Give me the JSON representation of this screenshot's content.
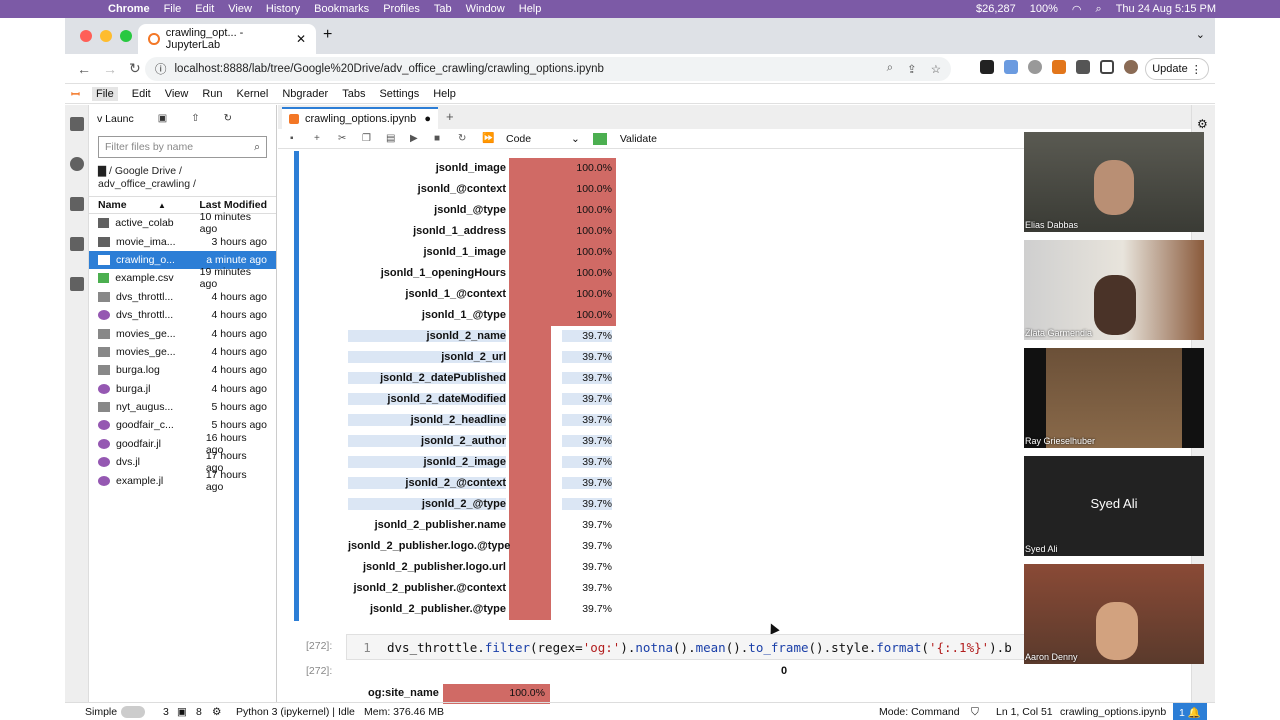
{
  "mac_menubar": {
    "app": "Chrome",
    "items": [
      "File",
      "Edit",
      "View",
      "History",
      "Bookmarks",
      "Profiles",
      "Tab",
      "Window",
      "Help"
    ],
    "right": [
      "$26,287",
      "100%",
      "Thu 24 Aug  5:15 PM"
    ]
  },
  "browser_tab": {
    "title": "crawling_opt... - JupyterLab"
  },
  "address": {
    "url": "localhost:8888/lab/tree/Google%20Drive/adv_office_crawling/crawling_options.ipynb"
  },
  "update_label": "Update",
  "jupyter_menu": [
    "File",
    "Edit",
    "View",
    "Run",
    "Kernel",
    "Nbgrader",
    "Tabs",
    "Settings",
    "Help"
  ],
  "file_browser": {
    "launcher_label": "v Launc",
    "filter_placeholder": "Filter files by name",
    "breadcrumb": "/ Google Drive / adv_office_crawling /",
    "col_name": "Name",
    "col_modified": "Last Modified",
    "files": [
      {
        "name": "active_colab",
        "modified": "10 minutes ago",
        "type": "folder"
      },
      {
        "name": "movie_ima...",
        "modified": "3 hours ago",
        "type": "folder"
      },
      {
        "name": "crawling_o...",
        "modified": "a minute ago",
        "type": "notebook",
        "selected": true
      },
      {
        "name": "example.csv",
        "modified": "19 minutes ago",
        "type": "csv"
      },
      {
        "name": "dvs_throttl...",
        "modified": "4 hours ago",
        "type": "file"
      },
      {
        "name": "dvs_throttl...",
        "modified": "4 hours ago",
        "type": "julia"
      },
      {
        "name": "movies_ge...",
        "modified": "4 hours ago",
        "type": "file"
      },
      {
        "name": "movies_ge...",
        "modified": "4 hours ago",
        "type": "file"
      },
      {
        "name": "burga.log",
        "modified": "4 hours ago",
        "type": "file"
      },
      {
        "name": "burga.jl",
        "modified": "4 hours ago",
        "type": "julia"
      },
      {
        "name": "nyt_augus...",
        "modified": "5 hours ago",
        "type": "file"
      },
      {
        "name": "goodfair_c...",
        "modified": "5 hours ago",
        "type": "julia"
      },
      {
        "name": "goodfair.jl",
        "modified": "16 hours ago",
        "type": "julia"
      },
      {
        "name": "dvs.jl",
        "modified": "17 hours ago",
        "type": "julia"
      },
      {
        "name": "example.jl",
        "modified": "17 hours ago",
        "type": "julia"
      }
    ]
  },
  "notebook": {
    "tab_title": "crawling_options.ipynb",
    "cell_type": "Code",
    "validate_label": "Validate",
    "rows": [
      {
        "label": "jsonld_image",
        "pct": "100.0%",
        "fraction": 1.0
      },
      {
        "label": "jsonld_@context",
        "pct": "100.0%",
        "fraction": 1.0
      },
      {
        "label": "jsonld_@type",
        "pct": "100.0%",
        "fraction": 1.0
      },
      {
        "label": "jsonld_1_address",
        "pct": "100.0%",
        "fraction": 1.0
      },
      {
        "label": "jsonld_1_image",
        "pct": "100.0%",
        "fraction": 1.0
      },
      {
        "label": "jsonld_1_openingHours",
        "pct": "100.0%",
        "fraction": 1.0
      },
      {
        "label": "jsonld_1_@context",
        "pct": "100.0%",
        "fraction": 1.0
      },
      {
        "label": "jsonld_1_@type",
        "pct": "100.0%",
        "fraction": 1.0
      },
      {
        "label": "jsonld_2_name",
        "pct": "39.7%",
        "fraction": 0.397,
        "hl": true
      },
      {
        "label": "jsonld_2_url",
        "pct": "39.7%",
        "fraction": 0.397,
        "hl": true
      },
      {
        "label": "jsonld_2_datePublished",
        "pct": "39.7%",
        "fraction": 0.397,
        "hl": true
      },
      {
        "label": "jsonld_2_dateModified",
        "pct": "39.7%",
        "fraction": 0.397,
        "hl": true
      },
      {
        "label": "jsonld_2_headline",
        "pct": "39.7%",
        "fraction": 0.397,
        "hl": true
      },
      {
        "label": "jsonld_2_author",
        "pct": "39.7%",
        "fraction": 0.397,
        "hl": true
      },
      {
        "label": "jsonld_2_image",
        "pct": "39.7%",
        "fraction": 0.397,
        "hl": true
      },
      {
        "label": "jsonld_2_@context",
        "pct": "39.7%",
        "fraction": 0.397,
        "hl": true
      },
      {
        "label": "jsonld_2_@type",
        "pct": "39.7%",
        "fraction": 0.397,
        "hl": true
      },
      {
        "label": "jsonld_2_publisher.name",
        "pct": "39.7%",
        "fraction": 0.397
      },
      {
        "label": "jsonld_2_publisher.logo.@type",
        "pct": "39.7%",
        "fraction": 0.397
      },
      {
        "label": "jsonld_2_publisher.logo.url",
        "pct": "39.7%",
        "fraction": 0.397
      },
      {
        "label": "jsonld_2_publisher.@context",
        "pct": "39.7%",
        "fraction": 0.397
      },
      {
        "label": "jsonld_2_publisher.@type",
        "pct": "39.7%",
        "fraction": 0.397
      }
    ],
    "input_prompt": "[272]:",
    "line_no": "1",
    "output_prompt": "[272]:",
    "col0_header": "0",
    "out_row": {
      "label": "og:site_name",
      "pct": "100.0%",
      "fraction": 1.0
    }
  },
  "statusbar": {
    "simple": "Simple",
    "kernels": "3",
    "terminals": "8",
    "kernel": "Python 3 (ipykernel) | Idle",
    "mem": "Mem: 376.46 MB",
    "mode": "Mode: Command",
    "pos": "Ln 1, Col 51",
    "file": "crawling_options.ipynb",
    "badge": "1"
  },
  "participants": [
    "Elias Dabbas",
    "Zlata Garmendia",
    "Ray Grieselhuber",
    "Syed Ali",
    "Aaron Denny"
  ],
  "syed_center": "Syed Ali",
  "colors": {
    "bar": "#d06a65",
    "accent": "#2c7ed6",
    "menubar": "#7c5aa6"
  }
}
